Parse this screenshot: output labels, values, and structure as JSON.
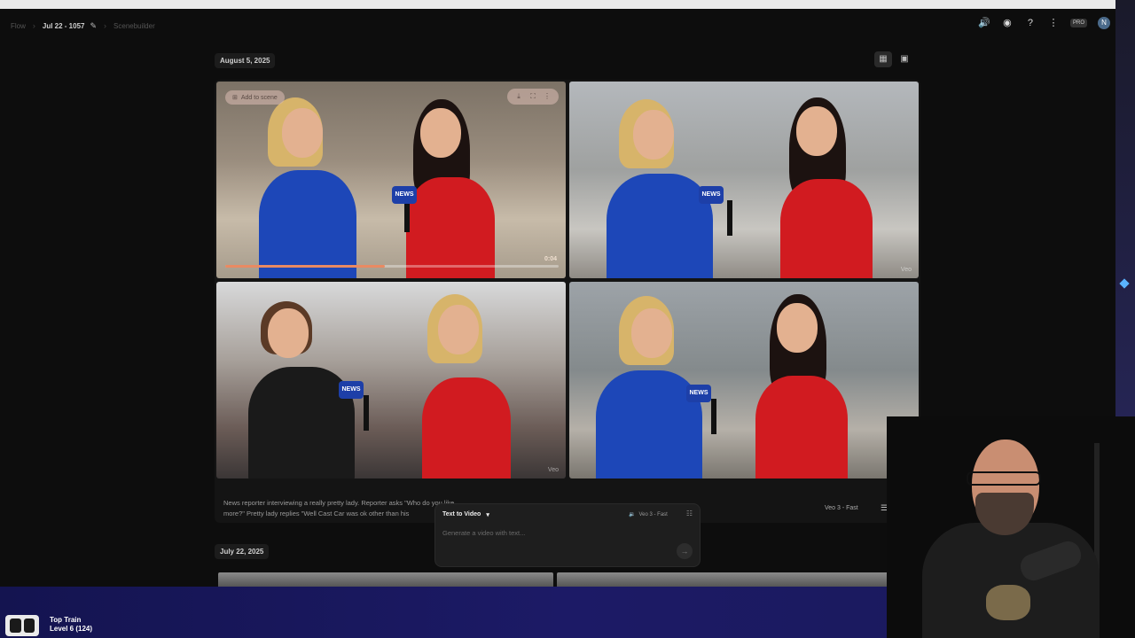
{
  "breadcrumb": {
    "root": "Flow",
    "project": "Jul 22 - 1057",
    "page": "Scenebuilder"
  },
  "header": {
    "pro_badge": "PRO",
    "avatar_initial": "N"
  },
  "section1": {
    "date": "August 5, 2025",
    "tile_actions": {
      "add_to_scene": "Add to scene"
    },
    "first_tile": {
      "timecode": "0:04",
      "progress": 0.48
    },
    "prompt": "News reporter interviewing a really pretty lady. Reporter asks \"Who do you like more?\" Pretty lady replies \"Well Cast Car was ok other than his",
    "model": "Veo 3 - Fast"
  },
  "composer": {
    "mode_label": "Text to Video",
    "model_label": "Veo 3 - Fast",
    "placeholder": "Generate a video with text..."
  },
  "section2": {
    "date": "July 22, 2025"
  },
  "stream_overlay": {
    "title": "Top Train",
    "level": "Level 6 (124)"
  },
  "tile_labels": {
    "mic_text": "NEWS",
    "watermark": "Veo"
  },
  "colors": {
    "background": "#0d0d0d",
    "progress_accent": "#e98a62",
    "stream_bar": "#1c1a66"
  }
}
